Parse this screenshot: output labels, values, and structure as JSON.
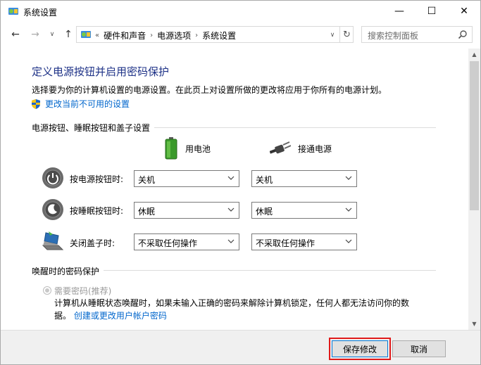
{
  "window": {
    "title": "系统设置",
    "controls": {
      "minimize": "—",
      "maximize": "☐",
      "close": "✕"
    }
  },
  "nav": {
    "back": "←",
    "forward": "→",
    "recent": "∨",
    "up": "↑",
    "breadcrumb_prefix": "«",
    "breadcrumbs": [
      "硬件和声音",
      "电源选项",
      "系统设置"
    ],
    "separator": "›",
    "dropdown": "∨",
    "refresh": "↻"
  },
  "search": {
    "placeholder": "搜索控制面板"
  },
  "page": {
    "heading": "定义电源按钮并启用密码保护",
    "description": "选择要为你的计算机设置的电源设置。在此页上对设置所做的更改将应用于你所有的电源计划。",
    "change_link": "更改当前不可用的设置"
  },
  "power_section": {
    "title": "电源按钮、睡眠按钮和盖子设置",
    "columns": {
      "battery": "用电池",
      "plugged": "接通电源"
    },
    "rows": [
      {
        "label": "按电源按钮时:",
        "battery": "关机",
        "plugged": "关机",
        "icon": "power-button-icon"
      },
      {
        "label": "按睡眠按钮时:",
        "battery": "休眠",
        "plugged": "休眠",
        "icon": "sleep-button-icon"
      },
      {
        "label": "关闭盖子时:",
        "battery": "不采取任何操作",
        "plugged": "不采取任何操作",
        "icon": "laptop-lid-icon"
      }
    ]
  },
  "password_section": {
    "title": "唤醒时的密码保护",
    "option": "需要密码(推荐)",
    "desc_line1": "计算机从睡眠状态唤醒时，如果未输入正确的密码来解除计算机锁定，任何人都无法访问你的数",
    "desc_line2_prefix": "据。",
    "desc_link": "创建或更改用户帐户密码"
  },
  "footer": {
    "save": "保存修改",
    "cancel": "取消"
  },
  "colors": {
    "heading": "#1e3287",
    "link": "#0066cc",
    "highlight": "#e01a1a"
  }
}
